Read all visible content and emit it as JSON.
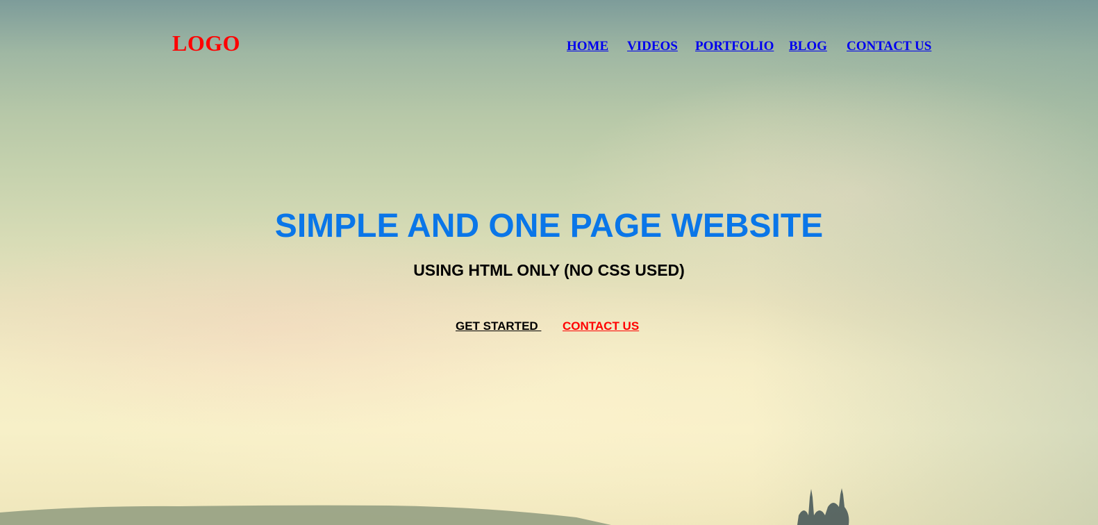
{
  "logo": {
    "text": "LOGO",
    "color": "#ff0000"
  },
  "nav": {
    "link_color": "#0000ee",
    "items": [
      {
        "label": "HOME"
      },
      {
        "label": "VIDEOS"
      },
      {
        "label": "PORTFOLIO"
      },
      {
        "label": "BLOG"
      },
      {
        "label": "CONTACT US"
      }
    ]
  },
  "hero": {
    "headline": "SIMPLE AND ONE PAGE WEBSITE",
    "headline_color": "#0a76e8",
    "subheadline": "USING HTML ONLY (NO CSS USED)"
  },
  "actions": {
    "get_started": "GET STARTED ",
    "contact": "CONTACT US",
    "contact_color": "#ff0000"
  }
}
